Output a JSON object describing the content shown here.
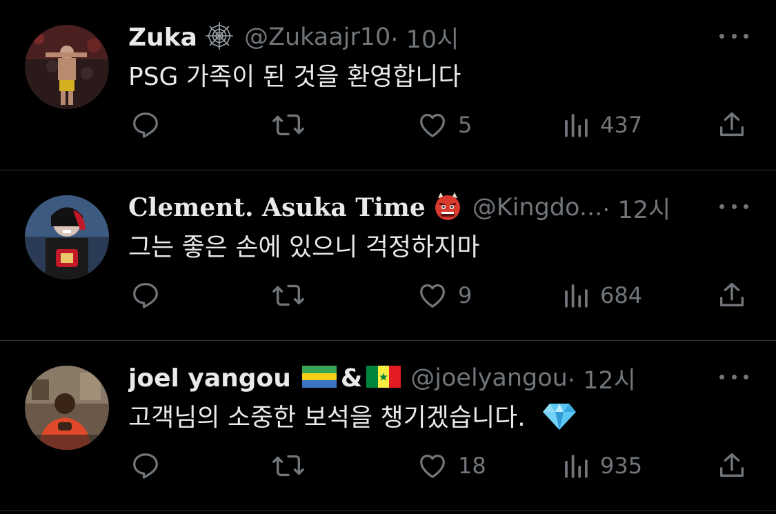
{
  "tweets": [
    {
      "name": "Zuka",
      "name_suffix_icon": "spider-web-icon",
      "handle": "@Zukaajr10",
      "time": " · 10시",
      "text": "PSG 가족이 된 것을 환영합니다",
      "likes": "5",
      "views": "437"
    },
    {
      "name": "Clement. Asuka Time",
      "name_suffix_icon": "ogre-emoji-icon",
      "handle": "@Kingdo...",
      "time": " · 12시",
      "text": "그는 좋은 손에 있으니 걱정하지마",
      "likes": "9",
      "views": "684"
    },
    {
      "name": "joel yangou",
      "name_suffix_icon": "flags-gabon-senegal-icon",
      "name_amp": "&",
      "handle": "@joelyangou",
      "time": " · 12시",
      "text": "고객님의 소중한 보석을 챙기겠습니다.",
      "text_suffix_icon": "gem-icon",
      "likes": "18",
      "views": "935"
    }
  ],
  "colors": {
    "background": "#000000",
    "text": "#e7e9ea",
    "secondary": "#71767b",
    "divider": "#2f3336"
  }
}
